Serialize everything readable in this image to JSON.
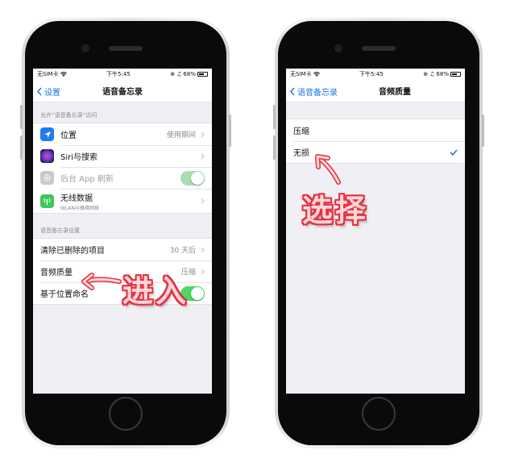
{
  "colors": {
    "accent_blue": "#1a73e8",
    "toggle_green": "#4cd964",
    "annotation_red": "#e4313f",
    "annotation_pink": "#fdd6d9",
    "location_icon_blue": "#1f7cf3",
    "wireless_icon_green": "#3cc85a"
  },
  "left_screen": {
    "status": {
      "carrier": "无SIM卡",
      "time": "下午5:45",
      "battery": "68%"
    },
    "nav": {
      "back_label": "设置",
      "title": "语音备忘录"
    },
    "section1_header": "允许“语音备忘录”访问",
    "section1_rows": [
      {
        "label": "位置",
        "value": "使用期间",
        "icon": "location-arrow-icon"
      },
      {
        "label": "Siri与搜索",
        "icon": "siri-icon"
      },
      {
        "label": "后台 App 刷新",
        "icon": "gear-icon"
      },
      {
        "label": "无线数据",
        "sublabel": "WLAN与蜂窝网络",
        "icon": "antenna-icon"
      }
    ],
    "section2_header": "语音备忘录设置",
    "section2_rows": [
      {
        "label": "清除已删除的项目",
        "value": "30 天后"
      },
      {
        "label": "音频质量",
        "value": "压缩"
      },
      {
        "label": "基于位置命名"
      }
    ]
  },
  "right_screen": {
    "status": {
      "carrier": "无SIM卡",
      "time": "下午5:45",
      "battery": "68%"
    },
    "nav": {
      "back_label": "语音备忘录",
      "title": "音频质量"
    },
    "options": [
      {
        "label": "压缩",
        "selected": false
      },
      {
        "label": "无损",
        "selected": true
      }
    ]
  },
  "annotations": {
    "enter": "进入",
    "select": "选择"
  }
}
